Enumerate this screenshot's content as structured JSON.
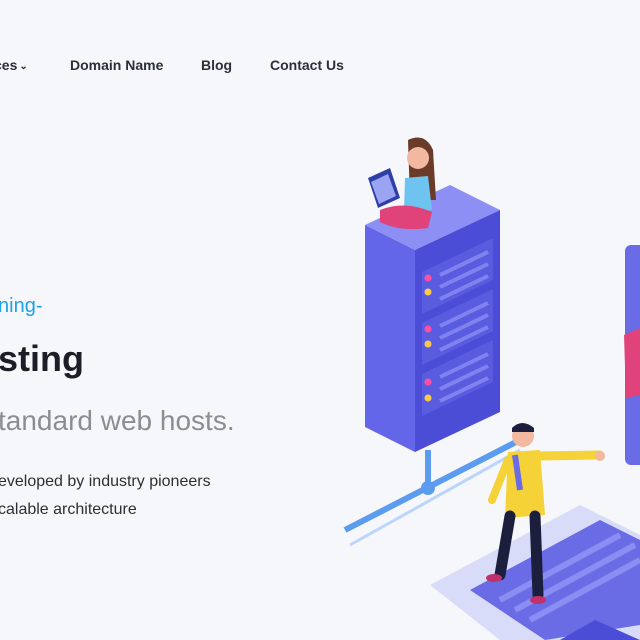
{
  "nav": {
    "items": [
      {
        "label": "ces",
        "has_dropdown": true
      },
      {
        "label": "Domain Name"
      },
      {
        "label": "Blog"
      },
      {
        "label": "Contact Us"
      }
    ],
    "chevron_icon": "chevron-down-icon"
  },
  "hero": {
    "tagline": "ning-",
    "headline": "sting",
    "subhead": "tandard web hosts.",
    "features": [
      "eveloped by industry pioneers",
      "calable architecture"
    ]
  },
  "colors": {
    "accent_blue": "#1fa2e5",
    "server_purple": "#6366e8",
    "background": "#f6f7fb"
  }
}
